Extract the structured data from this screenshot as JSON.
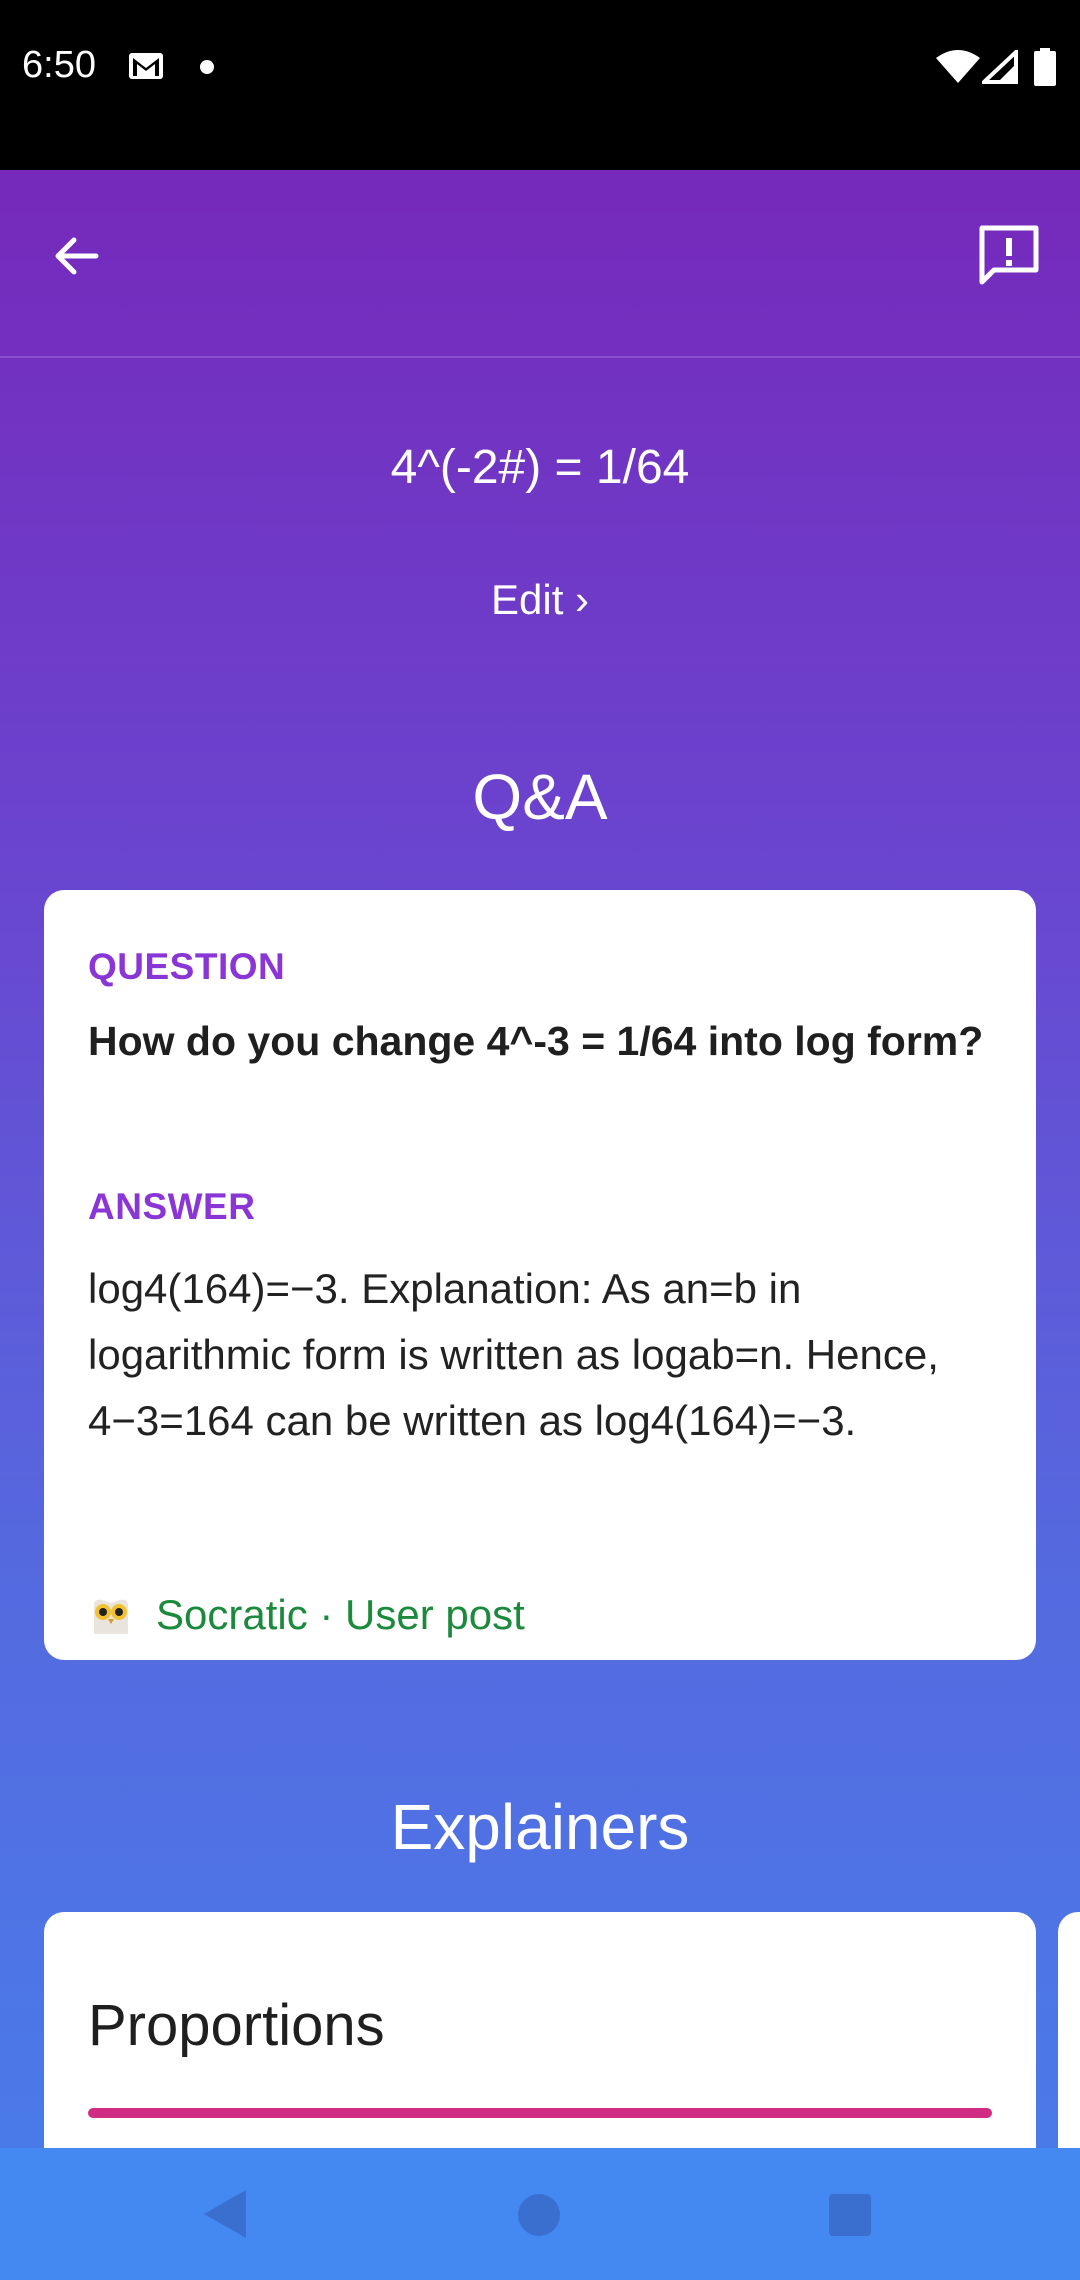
{
  "status_bar": {
    "time": "6:50"
  },
  "header": {
    "equation": "4^(-2#) = 1/64",
    "edit_label": "Edit ›"
  },
  "qa": {
    "section_title": "Q&A",
    "question_label": "QUESTION",
    "question_text": "How do you change 4^-3 = 1/64 into log form?",
    "answer_label": "ANSWER",
    "answer_text": "log4(164)=−3. Explanation: As an=b in logarithmic form is written as logab=n. Hence, 4−3=164 can be written as log4(164)=−3.",
    "source": "Socratic · User post"
  },
  "explainers": {
    "section_title": "Explainers",
    "cards": [
      {
        "title": "Proportions"
      }
    ]
  },
  "colors": {
    "gradient_top": "#7629bb",
    "gradient_bottom": "#4a7ae8",
    "label_purple": "#8a35d6",
    "source_green": "#1c8a3c",
    "progress_pink": "#d02c84",
    "nav_bar": "#4488f2"
  },
  "icons": [
    "gmail-icon",
    "dot-icon",
    "wifi-icon",
    "signal-icon",
    "battery-icon",
    "back-arrow-icon",
    "feedback-icon",
    "owl-icon",
    "nav-back-icon",
    "nav-home-icon",
    "nav-recents-icon"
  ]
}
